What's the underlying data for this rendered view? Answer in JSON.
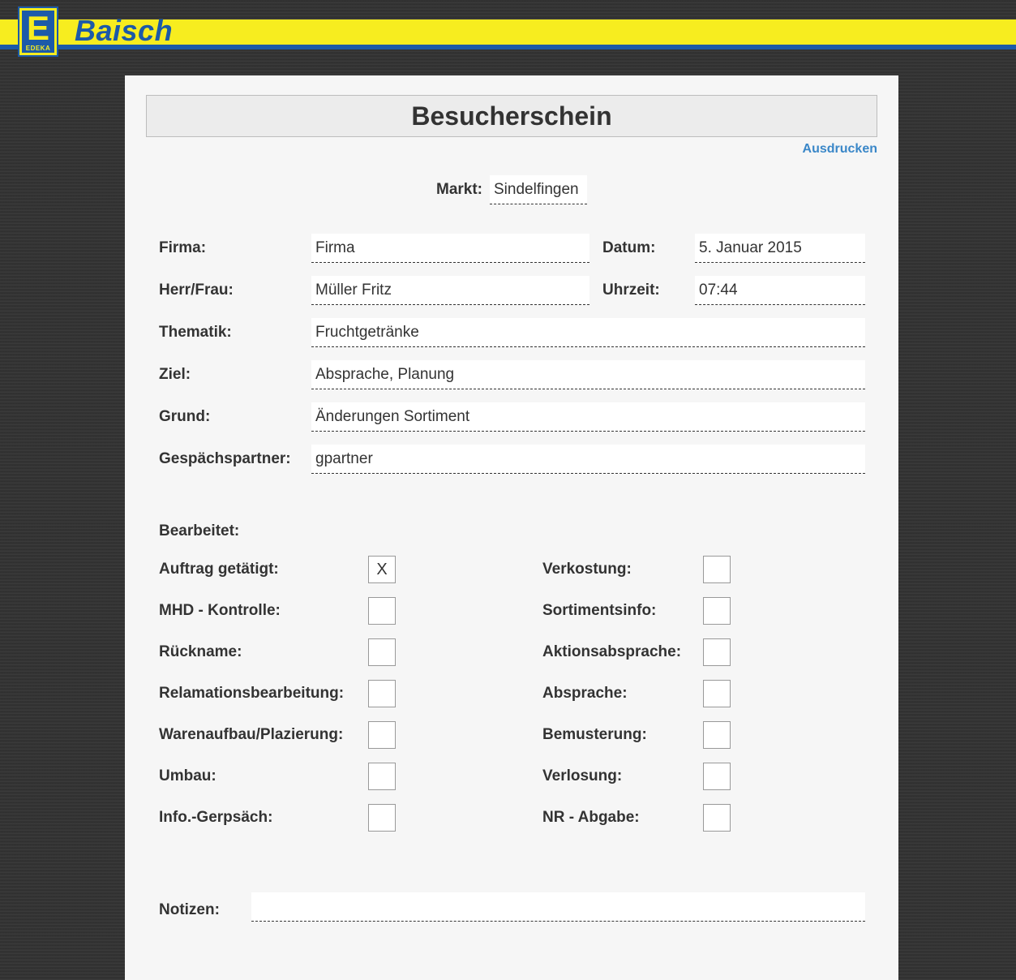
{
  "header": {
    "logo_letter": "E",
    "logo_sub": "EDEKA",
    "brand": "Baisch",
    "colors": {
      "yellow": "#f7ed1f",
      "blue": "#1c5aa8"
    }
  },
  "form": {
    "title": "Besucherschein",
    "print_label": "Ausdrucken",
    "markt": {
      "label": "Markt:",
      "value": "Sindelfingen"
    },
    "firma": {
      "label": "Firma:",
      "value": "Firma"
    },
    "datum": {
      "label": "Datum:",
      "value": "5. Januar 2015"
    },
    "herr_frau": {
      "label": "Herr/Frau:",
      "value": "Müller Fritz"
    },
    "uhrzeit": {
      "label": "Uhrzeit:",
      "value": "07:44"
    },
    "thematik": {
      "label": "Thematik:",
      "value": "Fruchtgetränke"
    },
    "ziel": {
      "label": "Ziel:",
      "value": "Absprache, Planung"
    },
    "grund": {
      "label": "Grund:",
      "value": "Änderungen Sortiment"
    },
    "gespraechspartner": {
      "label": "Gespächspartner:",
      "value": "gpartner"
    },
    "bearbeitet_label": "Bearbeitet:",
    "checks_left": [
      {
        "label": "Auftrag getätigt:",
        "mark": "X"
      },
      {
        "label": "MHD - Kontrolle:",
        "mark": ""
      },
      {
        "label": "Rückname:",
        "mark": ""
      },
      {
        "label": "Relamationsbearbeitung:",
        "mark": ""
      },
      {
        "label": "Warenaufbau/Plazierung:",
        "mark": ""
      },
      {
        "label": "Umbau:",
        "mark": ""
      },
      {
        "label": "Info.-Gerpsäch:",
        "mark": ""
      }
    ],
    "checks_right": [
      {
        "label": "Verkostung:",
        "mark": ""
      },
      {
        "label": "Sortimentsinfo:",
        "mark": ""
      },
      {
        "label": "Aktionsabsprache:",
        "mark": ""
      },
      {
        "label": "Absprache:",
        "mark": ""
      },
      {
        "label": "Bemusterung:",
        "mark": ""
      },
      {
        "label": "Verlosung:",
        "mark": ""
      },
      {
        "label": "NR - Abgabe:",
        "mark": ""
      }
    ],
    "notizen": {
      "label": "Notizen:",
      "value": ""
    }
  }
}
